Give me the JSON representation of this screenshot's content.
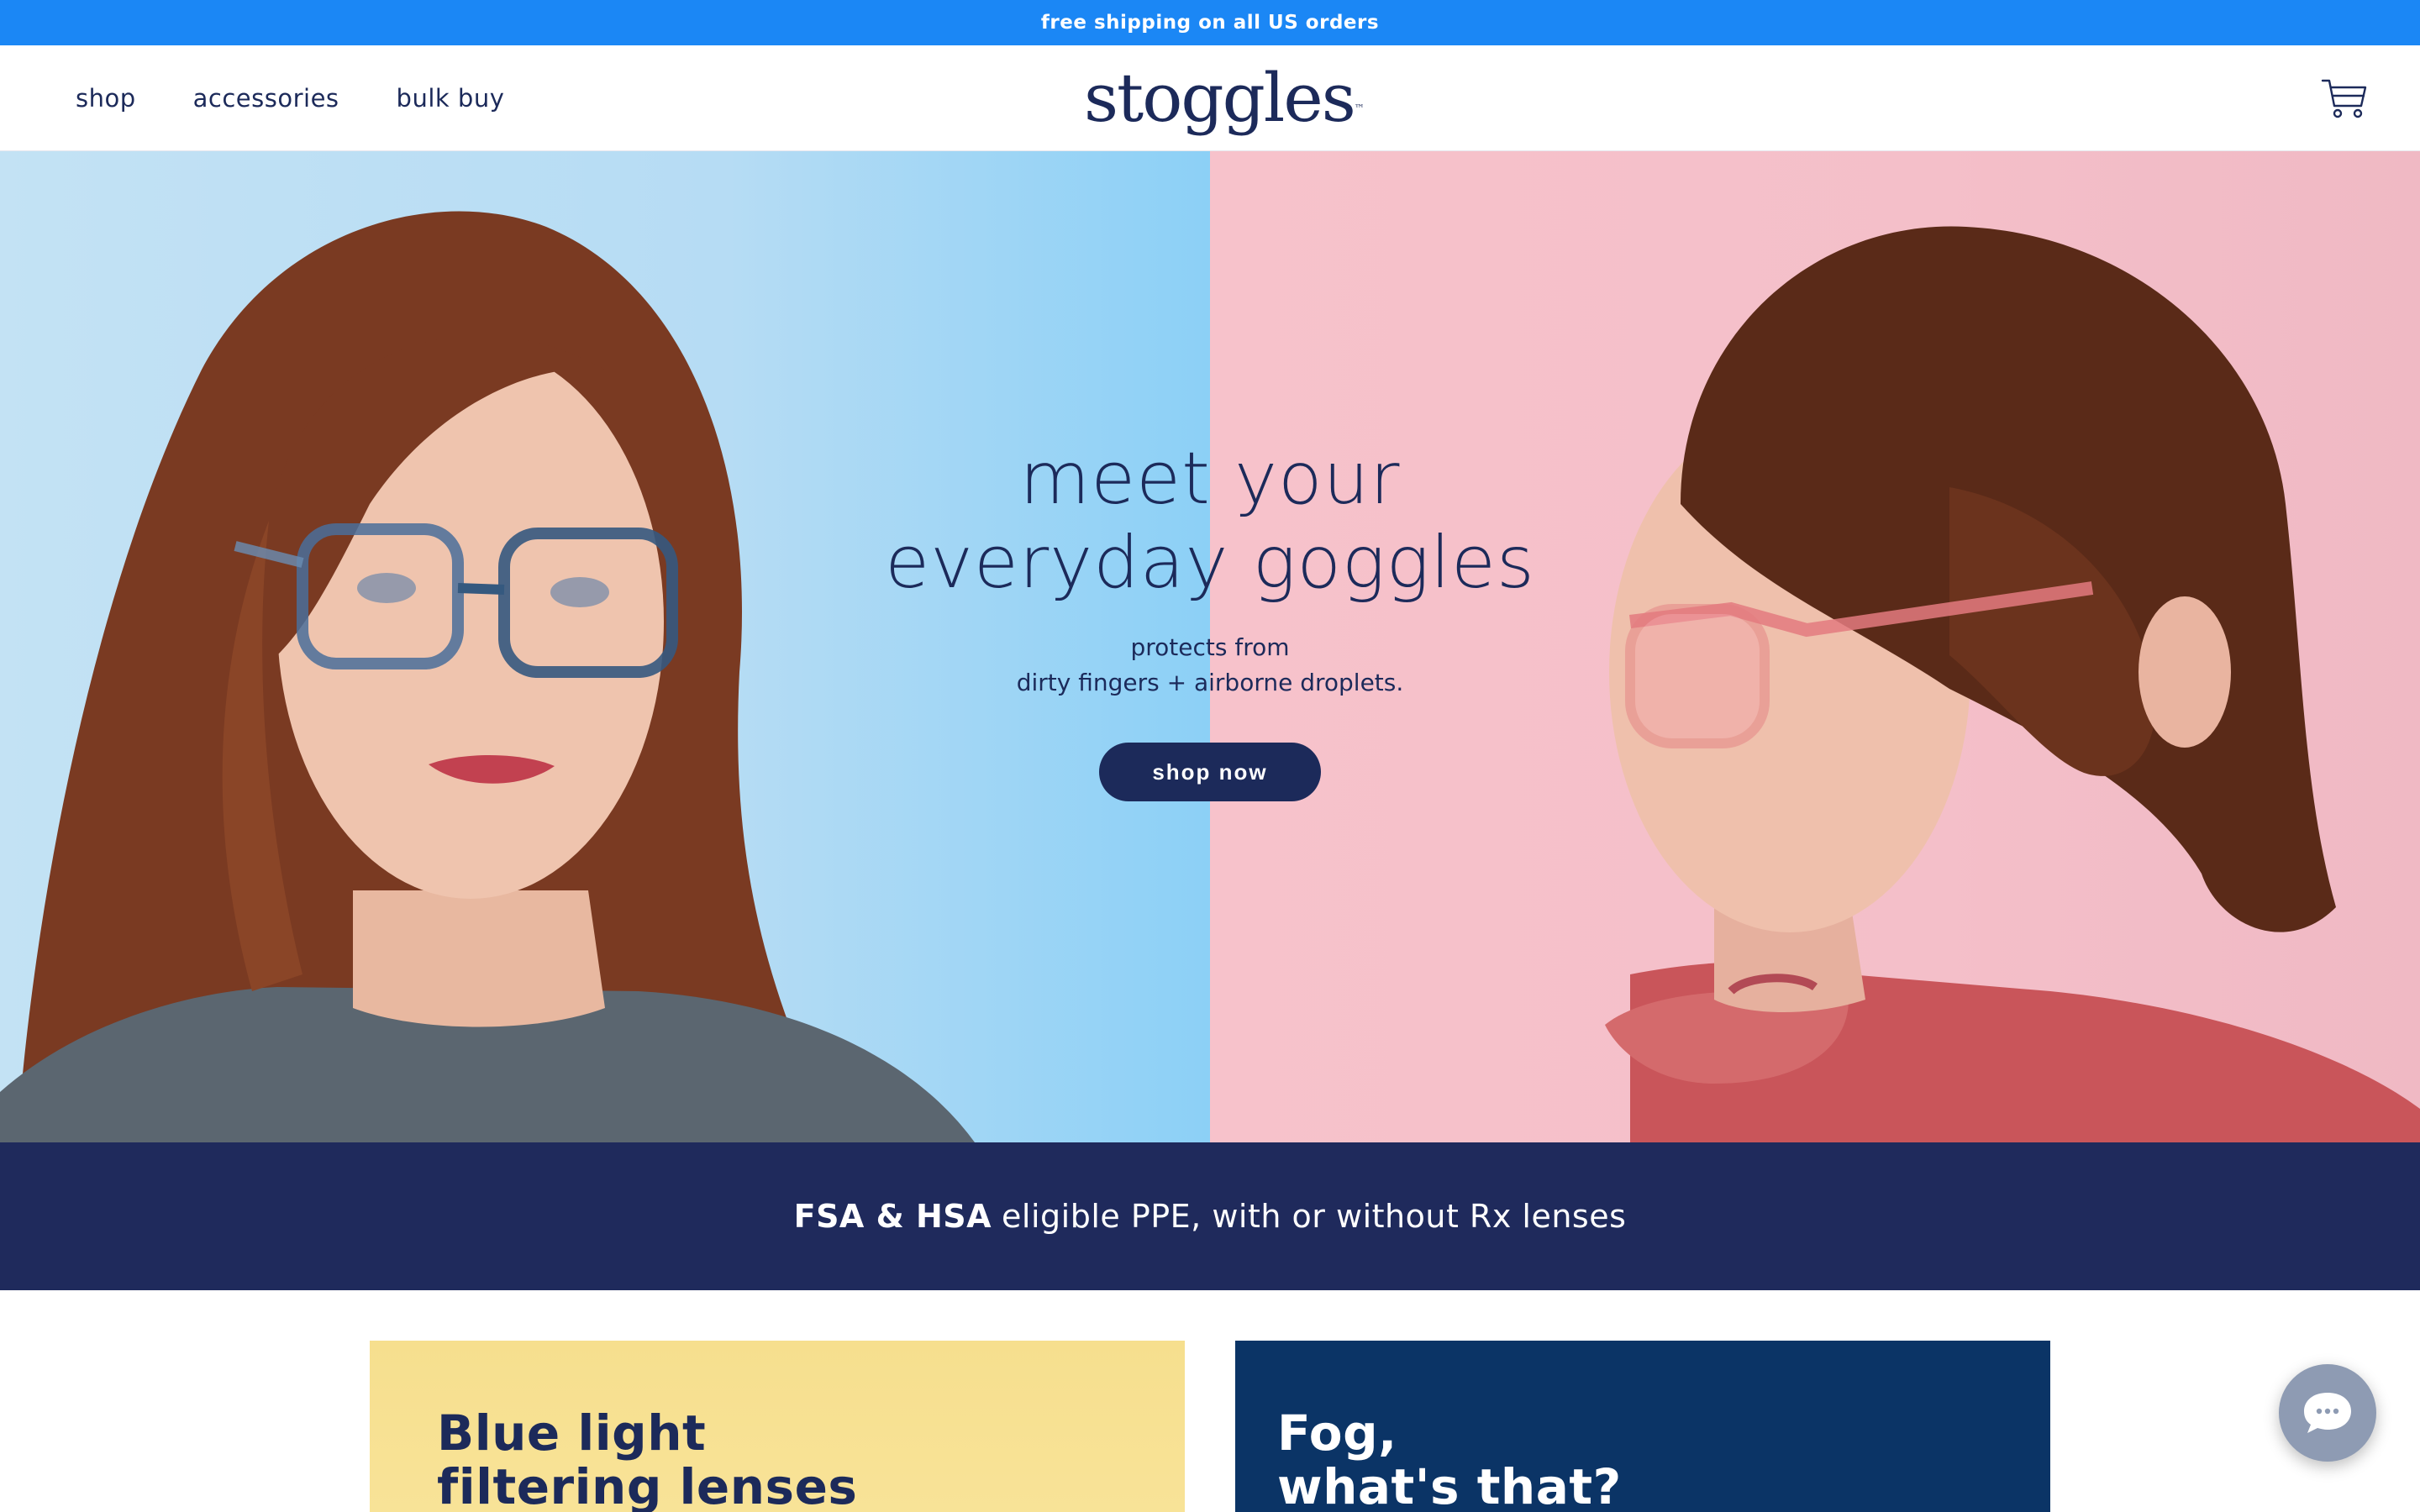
{
  "announcement": {
    "text": "free shipping on all US orders"
  },
  "header": {
    "nav": [
      {
        "label": "shop"
      },
      {
        "label": "accessories"
      },
      {
        "label": "bulk buy"
      }
    ],
    "logo": {
      "text": "stoggles",
      "tm": "™"
    },
    "cart_icon": "shopping-cart-icon"
  },
  "hero": {
    "title_line1": "meet your",
    "title_line2": "everyday goggles",
    "sub_line1": "protects from",
    "sub_line2": "dirty fingers + airborne droplets.",
    "button_label": "shop now",
    "left_bg": "#b6dcf4",
    "right_bg": "#f4bfc9"
  },
  "fsa": {
    "bold": "FSA & HSA",
    "text": "eligible PPE, with or without Rx lenses"
  },
  "cards": [
    {
      "line1": "Blue light",
      "line2": "filtering lenses",
      "bg": "#f7e08f"
    },
    {
      "line1": "Fog,",
      "line2": "what's that?",
      "bg": "#0b3466"
    }
  ],
  "chat": {
    "icon": "chat-bubble-icon"
  },
  "colors": {
    "brand_navy": "#1c2a5a",
    "announce_blue": "#1b87f5"
  }
}
